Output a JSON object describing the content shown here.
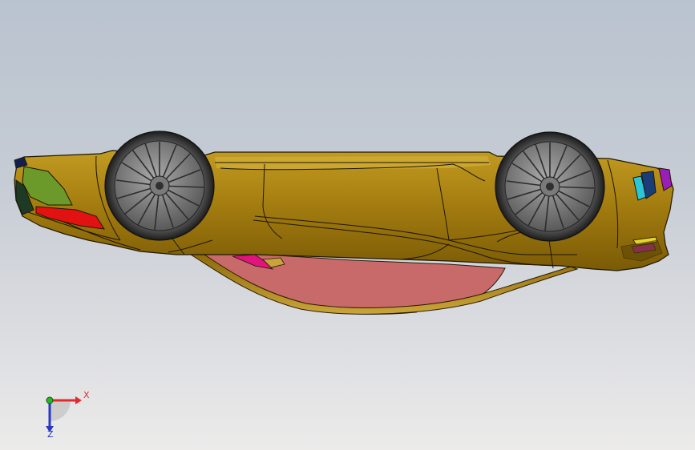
{
  "viewport": {
    "background_top": "#b9c3cf",
    "background_bottom": "#ecebea",
    "model_color": "#a77f10",
    "model_edge": "#1e1602"
  },
  "triad": {
    "x_label": "X",
    "z_label": "Z",
    "x_color": "#e32a2a",
    "y_color": "#25b525",
    "z_color": "#2a36c4"
  }
}
